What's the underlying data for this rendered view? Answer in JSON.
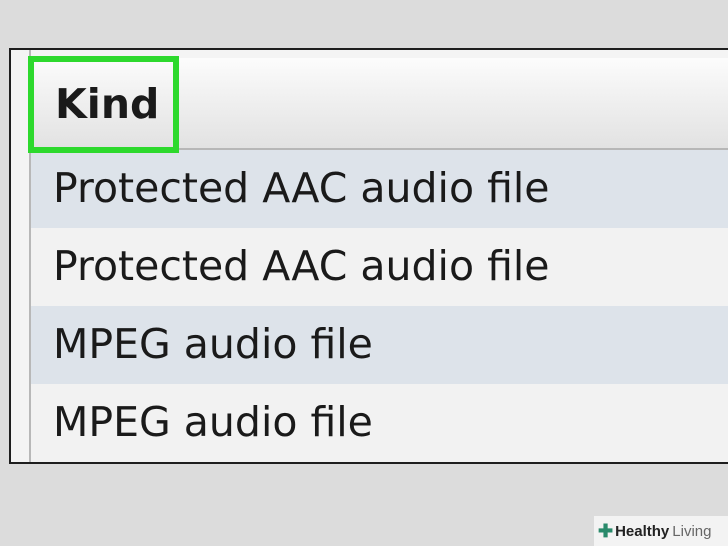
{
  "list": {
    "column_header": "Kind",
    "rows": [
      "Protected AAC audio file",
      "Protected AAC audio file",
      "MPEG audio file",
      "MPEG audio file"
    ]
  },
  "highlight": {
    "color": "#2dd92d",
    "target": "Kind"
  },
  "watermark": {
    "icon": "plus-cross-icon",
    "word1": "Healthy",
    "word2": "Living"
  }
}
